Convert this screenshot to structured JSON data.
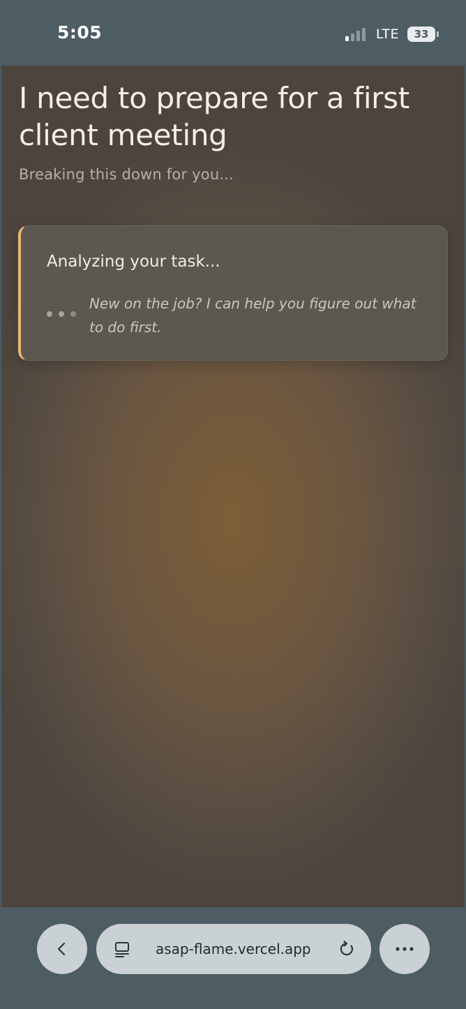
{
  "status_bar": {
    "time": "5:05",
    "network": "LTE",
    "battery": "33",
    "signal_bars_active": 1,
    "signal_bars_total": 4
  },
  "page": {
    "title": "I need to prepare for a first client meeting",
    "subtitle": "Breaking this down for you...",
    "card": {
      "heading": "Analyzing your task...",
      "message": "New on the job? I can help you figure out what to do first."
    }
  },
  "browser": {
    "url": "asap-flame.vercel.app",
    "icons": [
      "chevron-left-icon",
      "tabs-icon",
      "reload-icon",
      "more-icon"
    ]
  },
  "colors": {
    "accent": "#e8b77a",
    "chrome": "#4e5c63",
    "pill": "#c9d1d4"
  }
}
